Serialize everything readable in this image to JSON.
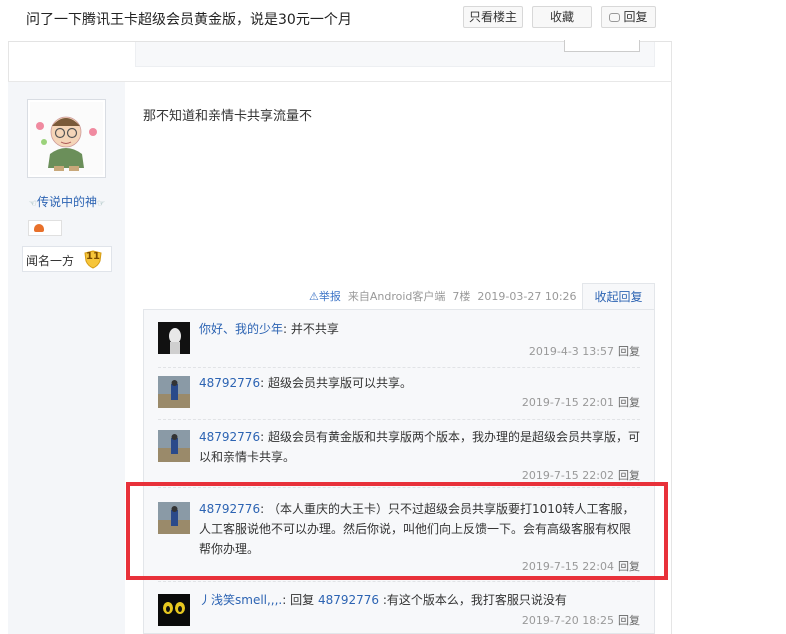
{
  "topbar": {
    "title": "问了一下腾讯王卡超级会员黄金版，说是30元一个月",
    "louzhu_label": "只看楼主",
    "shoucang_label": "收藏",
    "huifu_label": "回复"
  },
  "author": {
    "name": "传说中的神",
    "level_name": "闻名一方",
    "level_num": "11"
  },
  "post": {
    "content": "那不知道和亲情卡共享流量不",
    "report": "举报",
    "source": "来自Android客户端",
    "floor": "7楼",
    "time": "2019-03-27 10:26",
    "collapse": "收起回复"
  },
  "replies": [
    {
      "name": "你好、我的少年",
      "sep": ":",
      "text": "并不共享",
      "time": "2019-4-3 13:57",
      "reply": "回复"
    },
    {
      "name": "48792776",
      "sep": ":",
      "text": "超级会员共享版可以共享。",
      "time": "2019-7-15 22:01",
      "reply": "回复"
    },
    {
      "name": "48792776",
      "sep": ":",
      "text": "超级会员有黄金版和共享版两个版本，我办理的是超级会员共享版，可以和亲情卡共享。",
      "time": "2019-7-15 22:02",
      "reply": "回复"
    },
    {
      "name": "48792776",
      "sep": ":",
      "text": "（本人重庆的大王卡）只不过超级会员共享版要打1010转人工客服，人工客服说他不可以办理。然后你说，叫他们向上反馈一下。会有高级客服有权限帮你办理。",
      "time": "2019-7-15 22:04",
      "reply": "回复"
    },
    {
      "name": "丿浅笑smell,,,.",
      "sep": ":",
      "text_pre": "回复",
      "mention": "48792776",
      "text": ":有这个版本么，我打客服只说没有",
      "time": "2019-7-20 18:25",
      "reply": "回复"
    }
  ],
  "colors": {
    "link": "#2d64b3",
    "highlight": "#e8313a"
  }
}
